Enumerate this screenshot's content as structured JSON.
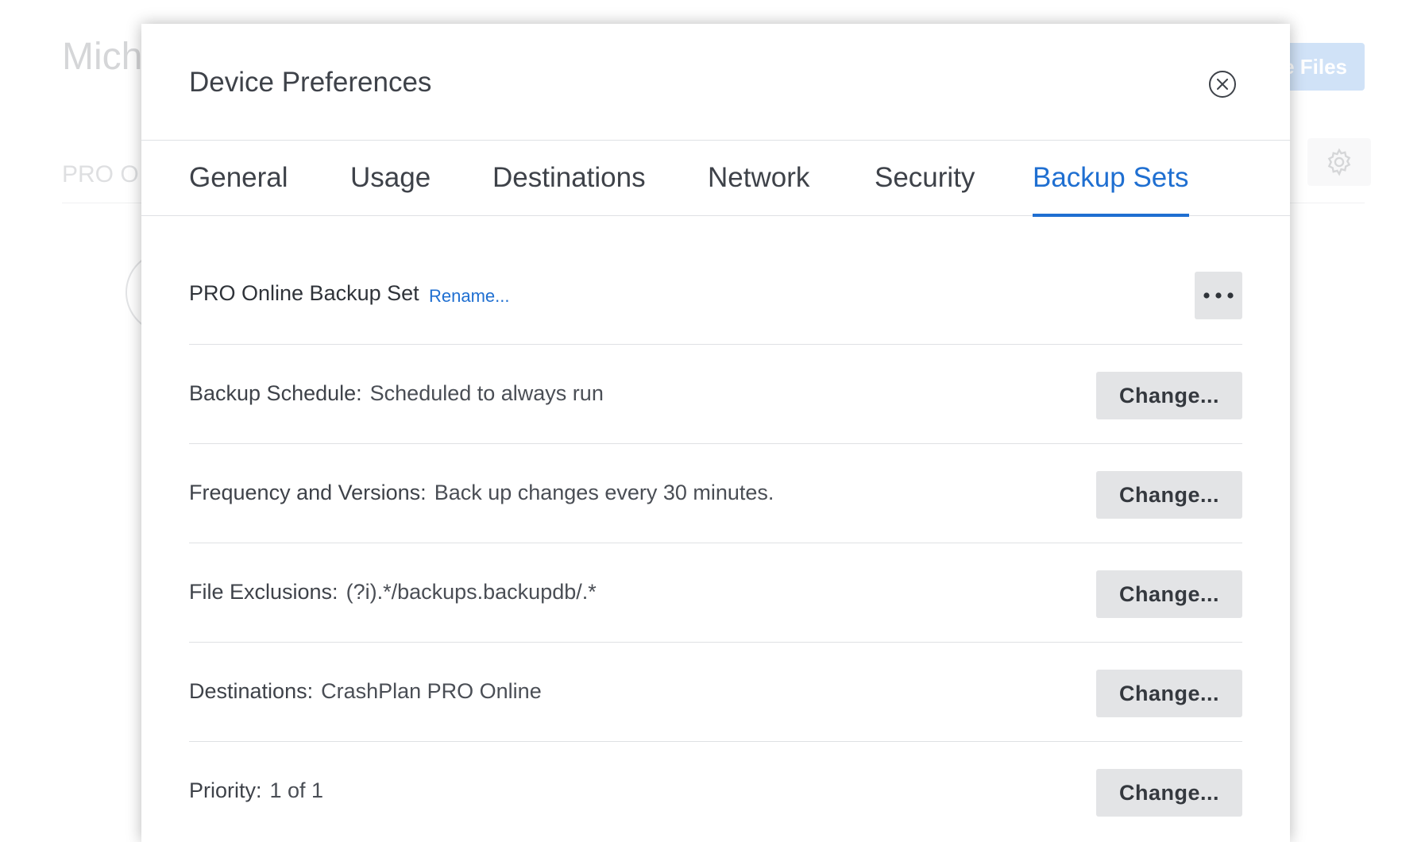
{
  "background": {
    "title": "Mich",
    "button_label": "e Files",
    "subtitle": "PRO O"
  },
  "modal": {
    "title": "Device Preferences",
    "tabs": [
      {
        "label": "General",
        "active": false
      },
      {
        "label": "Usage",
        "active": false
      },
      {
        "label": "Destinations",
        "active": false
      },
      {
        "label": "Network",
        "active": false
      },
      {
        "label": "Security",
        "active": false
      },
      {
        "label": "Backup Sets",
        "active": true
      }
    ],
    "backup_set": {
      "name": "PRO Online Backup Set",
      "rename_label": "Rename..."
    },
    "settings": [
      {
        "label": "Backup Schedule:",
        "value": "Scheduled to always run",
        "button": "Change..."
      },
      {
        "label": "Frequency and Versions:",
        "value": "Back up changes every 30 minutes.",
        "button": "Change..."
      },
      {
        "label": "File Exclusions:",
        "value": "(?i).*/backups.backupdb/.*",
        "button": "Change..."
      },
      {
        "label": "Destinations:",
        "value": "CrashPlan PRO Online",
        "button": "Change..."
      },
      {
        "label": "Priority:",
        "value": "1 of 1",
        "button": "Change..."
      }
    ]
  },
  "colors": {
    "accent": "#1f6fd1",
    "button_bg": "#e3e4e6",
    "text": "#3e4249",
    "divider": "#dfe1e4"
  },
  "icons": [
    "close-icon",
    "more-dots-icon",
    "gear-icon"
  ]
}
